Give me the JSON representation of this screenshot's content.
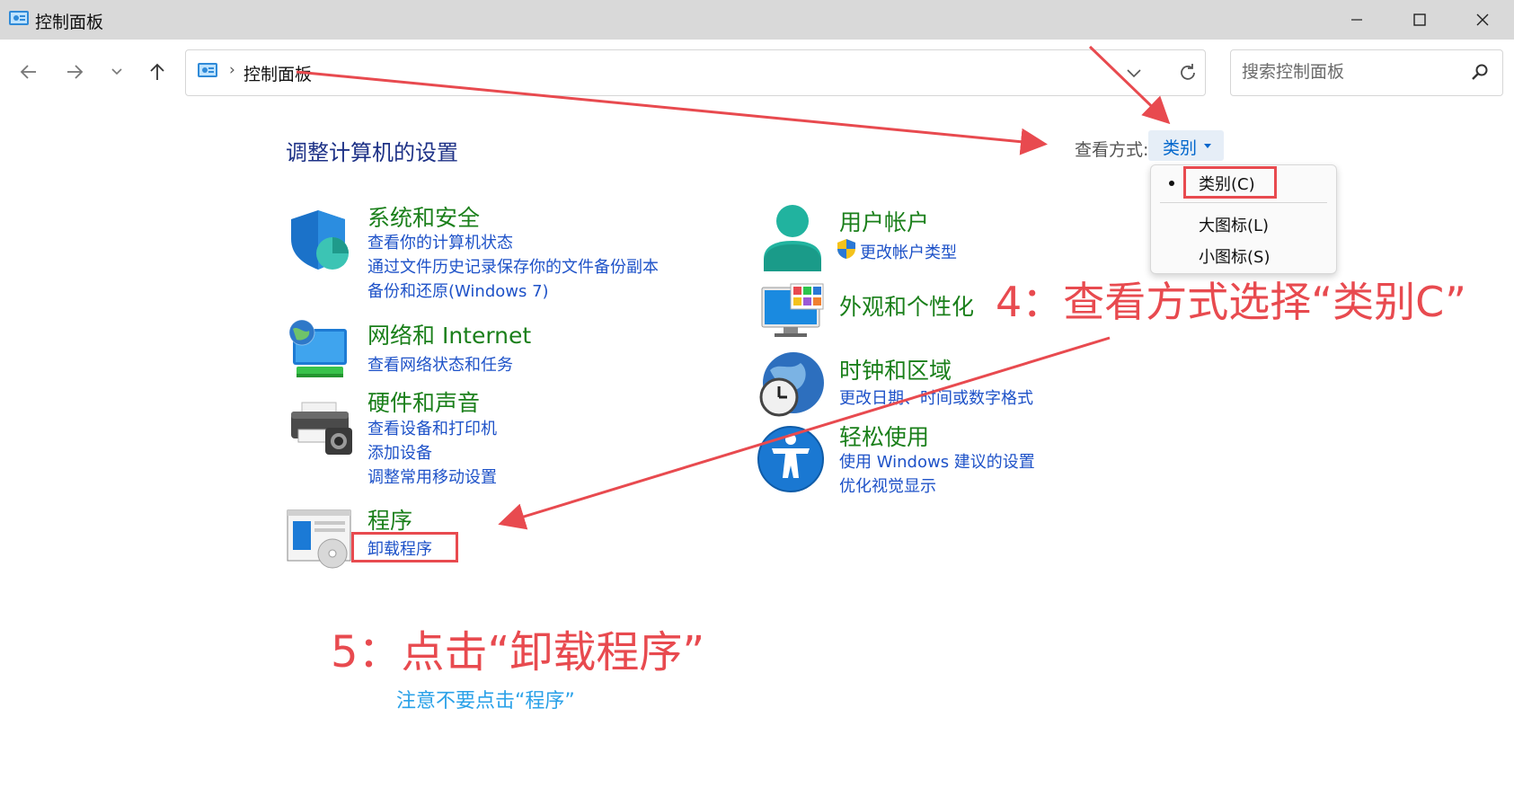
{
  "window": {
    "title": "控制面板",
    "controls": [
      "minimize-icon",
      "maximize-icon",
      "close-icon"
    ]
  },
  "nav": {
    "buttons": [
      "back-arrow-icon",
      "forward-arrow-icon",
      "chevron-down-icon",
      "up-arrow-icon"
    ],
    "breadcrumb": "控制面板",
    "search_placeholder": "搜索控制面板"
  },
  "header": {
    "title": "调整计算机的设置",
    "view_label": "查看方式:",
    "view_value": "类别"
  },
  "view_menu": {
    "items": [
      {
        "label": "类别(C)",
        "selected": true
      },
      {
        "label": "大图标(L)",
        "selected": false
      },
      {
        "label": "小图标(S)",
        "selected": false
      }
    ]
  },
  "categories": {
    "system": {
      "title": "系统和安全",
      "icon": "shield-icon",
      "links": [
        "查看你的计算机状态",
        "通过文件历史记录保存你的文件备份副本",
        "备份和还原(Windows 7)"
      ]
    },
    "network": {
      "title": "网络和 Internet",
      "icon": "network-globe-icon",
      "links": [
        "查看网络状态和任务"
      ]
    },
    "hardware": {
      "title": "硬件和声音",
      "icon": "printer-icon",
      "links": [
        "查看设备和打印机",
        "添加设备",
        "调整常用移动设置"
      ]
    },
    "programs": {
      "title": "程序",
      "icon": "programs-icon",
      "links": [
        "卸载程序"
      ]
    },
    "user": {
      "title": "用户帐户",
      "icon": "user-icon",
      "links": [
        "更改帐户类型"
      ]
    },
    "appearance": {
      "title": "外观和个性化",
      "icon": "monitor-icon",
      "links": []
    },
    "clock": {
      "title": "时钟和区域",
      "icon": "clock-globe-icon",
      "links": [
        "更改日期、时间或数字格式"
      ]
    },
    "ease": {
      "title": "轻松使用",
      "icon": "accessibility-icon",
      "links": [
        "使用 Windows 建议的设置",
        "优化视觉显示"
      ]
    }
  },
  "annotations": {
    "step4": "4：查看方式选择“类别C”",
    "step5": "5：点击“卸载程序”",
    "note": "注意不要点击“程序”",
    "color": "#e84a4f",
    "note_color": "#2aa1e8"
  }
}
